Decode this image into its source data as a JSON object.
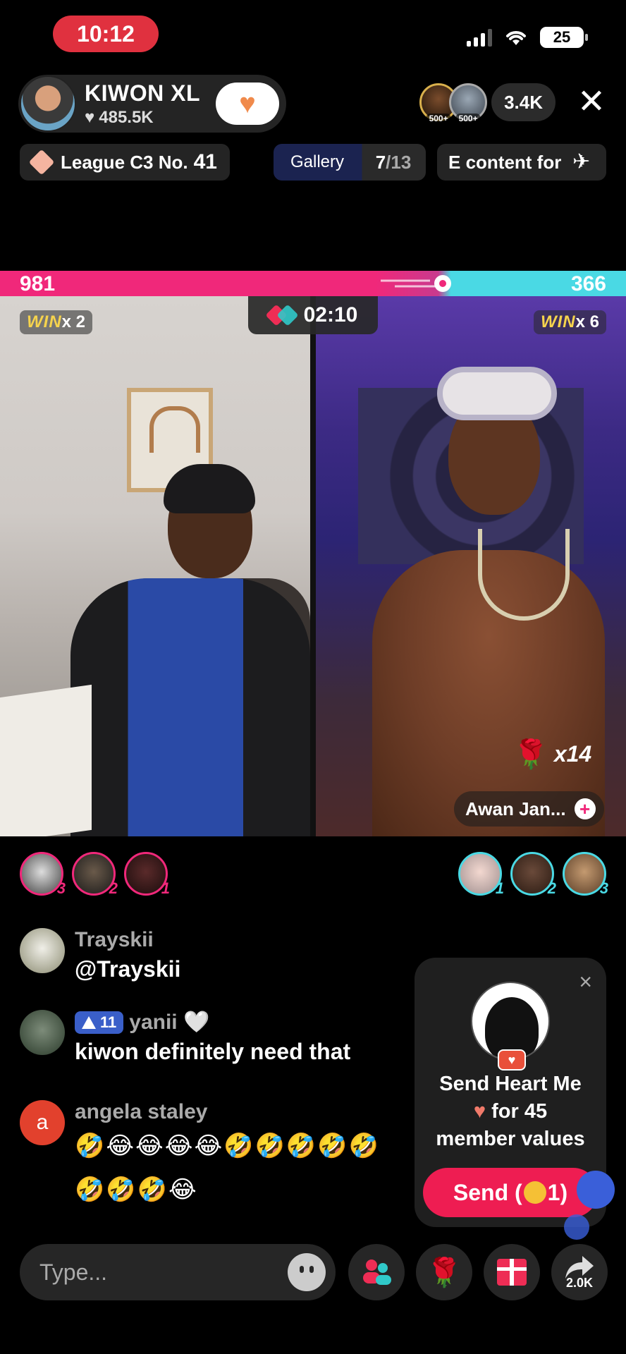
{
  "status_bar": {
    "time": "10:12",
    "battery": "25"
  },
  "host": {
    "name": "KIWON XL",
    "likes": "485.5K",
    "follow_heart_count": "1"
  },
  "viewers": {
    "badges": [
      "500+",
      "500+"
    ],
    "count": "3.4K"
  },
  "chips": {
    "league_label": "League C3 No.",
    "league_number": "41",
    "gallery_label": "Gallery",
    "gallery_current": "7",
    "gallery_total": "/13",
    "content_text": "E content for"
  },
  "battle": {
    "left_score": "981",
    "right_score": "366",
    "timer": "02:10",
    "left_win_label": "WIN",
    "left_win_count": "x 2",
    "right_win_label": "WIN",
    "right_win_count": "x 6",
    "rose_multiplier": "x14",
    "opponent_name": "Awan Jan...",
    "colors": {
      "left": "#f0287a",
      "right": "#4ad9e4"
    }
  },
  "gifters": {
    "left_ranks": [
      "3",
      "2",
      "1"
    ],
    "right_ranks": [
      "1",
      "2",
      "3"
    ]
  },
  "comments": [
    {
      "name": "Trayskii",
      "text": "@Trayskii"
    },
    {
      "name": "yanii 🤍",
      "level": "11",
      "text": "kiwon definitely need that"
    },
    {
      "name": "angela staley",
      "avatar_letter": "a",
      "emoji_line1": "🤣😂😂😂😂🤣🤣🤣🤣🤣",
      "emoji_line2": "🤣🤣🤣😂"
    }
  ],
  "popup": {
    "close": "×",
    "line1": "Send Heart Me",
    "line2": "for 45",
    "line3": "member values",
    "send_label": "Send (",
    "send_amount": "1)"
  },
  "bottom_bar": {
    "input_placeholder": "Type...",
    "share_count": "2.0K"
  }
}
